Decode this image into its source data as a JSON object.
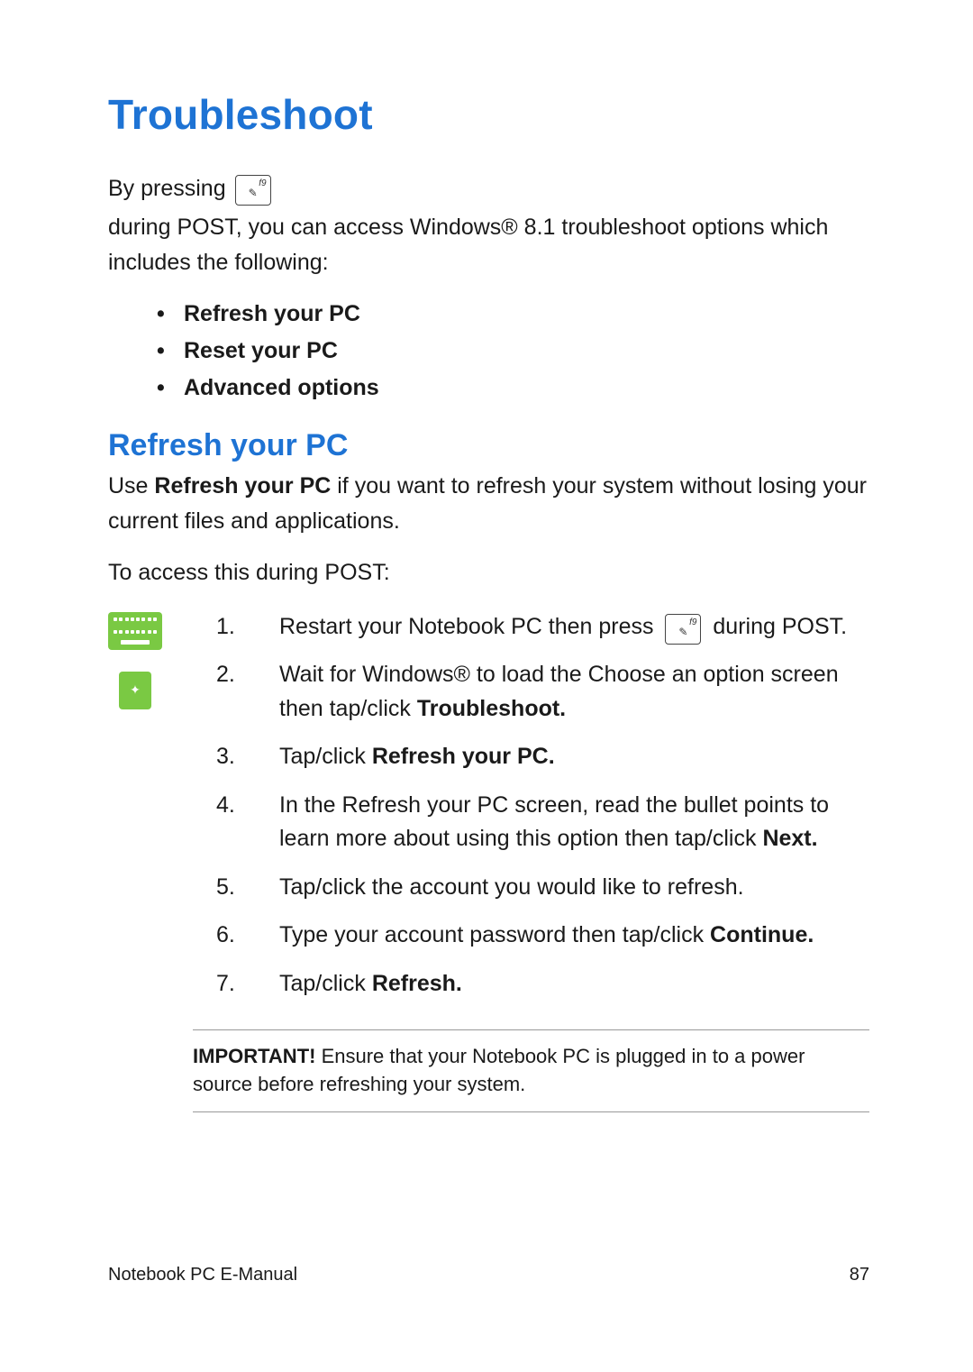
{
  "title": "Troubleshoot",
  "intro": {
    "p1a": "By pressing",
    "p1b": "during POST, you can access Windows® 8.1 troubleshoot options which includes the following:",
    "key_label": "f9"
  },
  "options": [
    "Refresh your PC",
    "Reset your PC",
    "Advanced options"
  ],
  "section": {
    "heading": "Refresh your PC",
    "p1a": "Use ",
    "p1b_bold": "Refresh your PC",
    "p1c": " if you want to refresh your system without losing your current files and applications.",
    "p2": "To access this during POST:"
  },
  "steps": {
    "s1a": "Restart your Notebook PC then press",
    "s1b": "during POST.",
    "s2a": "Wait for Windows® to load the Choose an option screen then tap/click ",
    "s2b_bold": "Troubleshoot.",
    "s3a": "Tap/click ",
    "s3b_bold": "Refresh your PC.",
    "s4a": "In the Refresh your PC screen, read the bullet points to learn more about using this option then tap/click ",
    "s4b_bold": "Next.",
    "s5": "Tap/click the account you would like to refresh.",
    "s6a": "Type your account password then tap/click ",
    "s6b_bold": "Continue.",
    "s7a": "Tap/click ",
    "s7b_bold": "Refresh."
  },
  "important": {
    "label": "IMPORTANT!",
    "text": " Ensure that your Notebook PC is plugged in to a power source before refreshing your system."
  },
  "footer": {
    "left": "Notebook PC E-Manual",
    "right": "87"
  }
}
